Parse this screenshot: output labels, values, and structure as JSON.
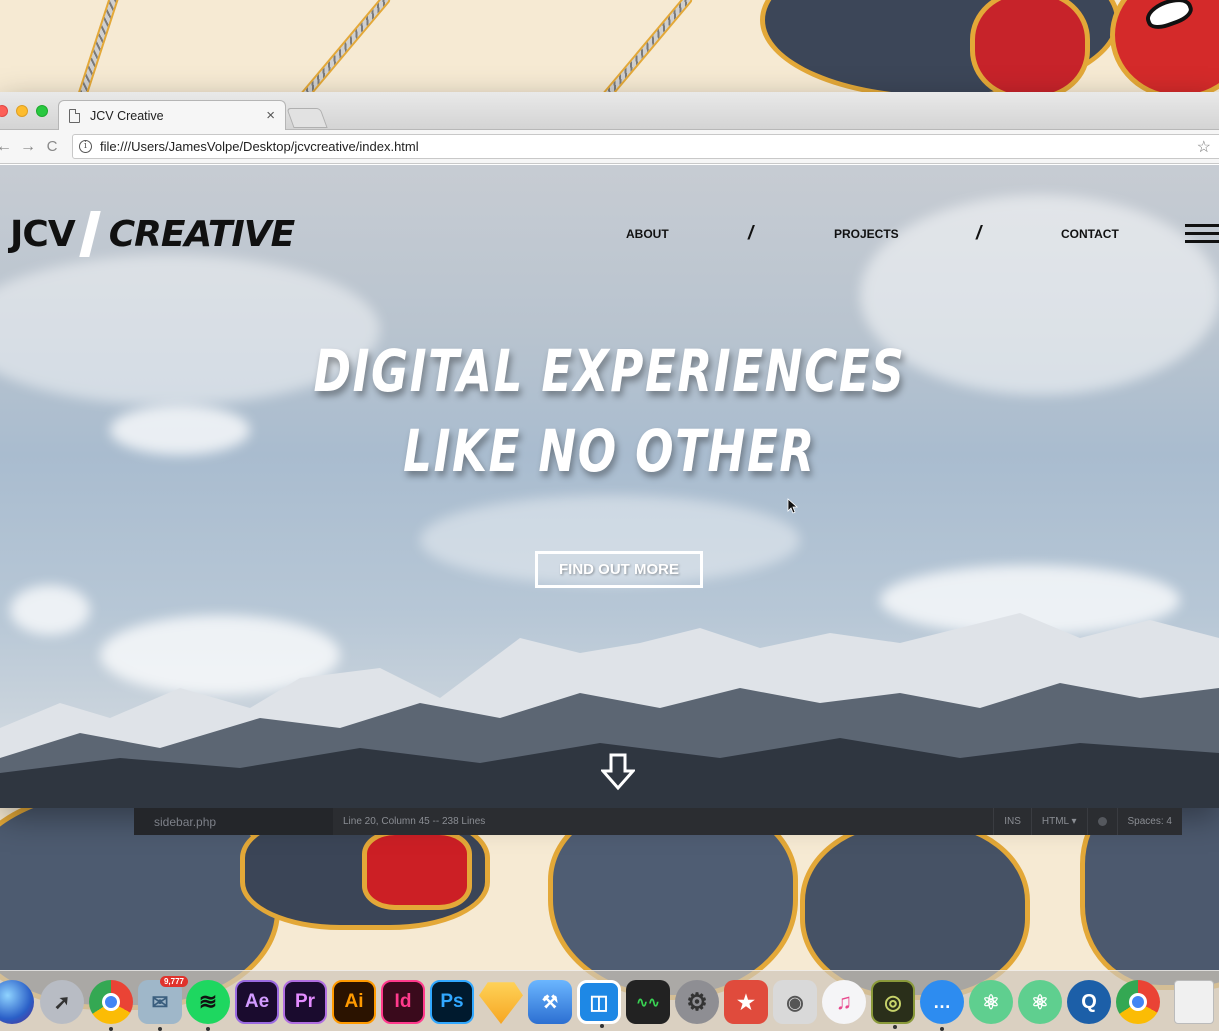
{
  "browser": {
    "tab_title": "JCV Creative",
    "tab_close": "×",
    "url": "file:///Users/JamesVolpe/Desktop/jcvcreative/index.html",
    "back": "←",
    "forward": "→",
    "reload": "C",
    "star": "☆",
    "info": "i"
  },
  "site": {
    "logo_left": "JCV",
    "logo_right": "CREATIVE",
    "nav": [
      {
        "label": "ABOUT"
      },
      {
        "label": "PROJECTS"
      },
      {
        "label": "CONTACT"
      }
    ],
    "nav_separator": "/",
    "headline_line1": "DIGITAL EXPERIENCES",
    "headline_line2": "LIKE NO OTHER",
    "cta_label": "FIND OUT MORE"
  },
  "editor_status": {
    "file": "sidebar.php",
    "position": "Line 20, Column 45 -- 238 Lines",
    "mode": "INS",
    "language": "HTML ▾",
    "spaces": "Spaces: 4"
  },
  "dock": {
    "badge": "9,777",
    "apps": [
      {
        "label": "Ae",
        "icon": "after-effects-icon"
      },
      {
        "label": "Pr",
        "icon": "premiere-icon"
      },
      {
        "label": "Ai",
        "icon": "illustrator-icon"
      },
      {
        "label": "Id",
        "icon": "indesign-icon"
      },
      {
        "label": "Ps",
        "icon": "photoshop-icon"
      }
    ]
  },
  "colors": {
    "traffic_close": "#fc5f57",
    "traffic_min": "#fdbc2e",
    "traffic_max": "#29c840",
    "editor_bar": "#2b2d31",
    "dock_bg": "#cec6ba"
  }
}
